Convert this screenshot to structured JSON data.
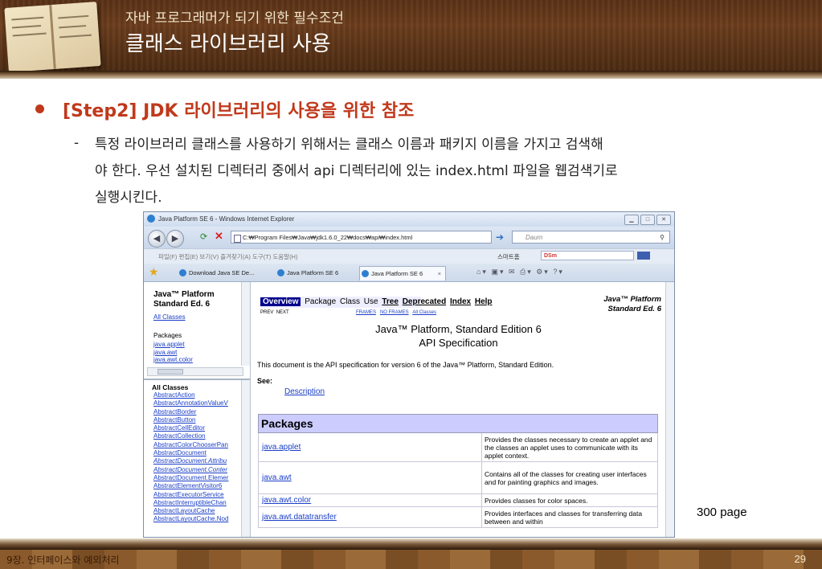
{
  "header": {
    "subtitle": "자바 프로그래머가 되기 위한 필수조건",
    "title": "클래스 라이브러리 사용"
  },
  "body": {
    "step_heading": "[Step2] JDK 라이브러리의 사용을 위한 참조",
    "dash": "-",
    "paragraph_lines": [
      "특정 라이브러리 클래스를 사용하기 위해서는 클래스 이름과 패키지 이름을 가지고 검색해",
      "야 한다. 우선 설치된 디렉터리 중에서 api 디렉터리에 있는 index.html 파일을 웹검색기로",
      "실행시킨다."
    ]
  },
  "browser": {
    "window_title": "Java Platform SE 6 - Windows Internet Explorer",
    "address": "C:₩Program Files₩Java₩jdk1.6.0_22₩docs₩api₩index.html",
    "search_placeholder": "Daum",
    "menu": "파일(F)   편집(E)   보기(V)   즐겨찾기(A)   도구(T)   도움말(H)",
    "smart_label": "스마트홈",
    "dsm_label": "DSm",
    "tabs": [
      "Download Java SE De...",
      "Java Platform SE 6",
      "Java Platform SE 6"
    ],
    "tab_close": "×",
    "left_top": {
      "platform_line1": "Java™ Platform",
      "platform_line2": "Standard Ed. 6",
      "all_classes_link": "All Classes",
      "packages_label": "Packages",
      "packages": [
        "java.applet",
        "java.awt",
        "java.awt.color"
      ]
    },
    "left_bottom": {
      "heading": "All Classes",
      "classes": [
        {
          "name": "AbstractAction",
          "italic": false
        },
        {
          "name": "AbstractAnnotationValueV",
          "italic": false
        },
        {
          "name": "AbstractBorder",
          "italic": false
        },
        {
          "name": "AbstractButton",
          "italic": false
        },
        {
          "name": "AbstractCellEditor",
          "italic": false
        },
        {
          "name": "AbstractCollection",
          "italic": false
        },
        {
          "name": "AbstractColorChooserPan",
          "italic": false
        },
        {
          "name": "AbstractDocument",
          "italic": false
        },
        {
          "name": "AbstractDocument.Attribu",
          "italic": true
        },
        {
          "name": "AbstractDocument.Conter",
          "italic": true
        },
        {
          "name": "AbstractDocument.Elemer",
          "italic": false
        },
        {
          "name": "AbstractElementVisitor6",
          "italic": false
        },
        {
          "name": "AbstractExecutorService",
          "italic": false
        },
        {
          "name": "AbstractInterruptibleChan",
          "italic": false
        },
        {
          "name": "AbstractLayoutCache",
          "italic": false
        },
        {
          "name": "AbstractLayoutCache.Nod",
          "italic": false
        }
      ]
    },
    "right": {
      "navbar": {
        "overview": "Overview",
        "package": "Package",
        "class": "Class",
        "use": "Use",
        "tree": "Tree",
        "deprecated": "Deprecated",
        "index": "Index",
        "help": "Help"
      },
      "java_right_line1": "Java™ Platform",
      "java_right_line2": "Standard Ed. 6",
      "prev": "PREV",
      "next": "NEXT",
      "frames": "FRAMES",
      "no_frames": "NO FRAMES",
      "all_classes": "All Classes",
      "heading_line1": "Java™ Platform, Standard Edition 6",
      "heading_line2": "API Specification",
      "description_sentence": "This document is the API specification for version 6 of the Java™ Platform, Standard Edition.",
      "see_label": "See:",
      "description_link": "Description",
      "packages_heading": "Packages",
      "packages": [
        {
          "name": "java.applet",
          "desc": "Provides the classes necessary to create an applet and the classes an applet uses to communicate with its applet context."
        },
        {
          "name": "java.awt",
          "desc": "Contains all of the classes for creating user interfaces and for painting graphics and images."
        },
        {
          "name": "java.awt.color",
          "desc": "Provides classes for color spaces."
        },
        {
          "name": "java.awt.datatransfer",
          "desc": "Provides interfaces and classes for transferring data between and within"
        }
      ]
    }
  },
  "page_label": "300 page",
  "footer": {
    "chapter": "9장. 인터페이스와 예외처리",
    "page_number": "29"
  }
}
